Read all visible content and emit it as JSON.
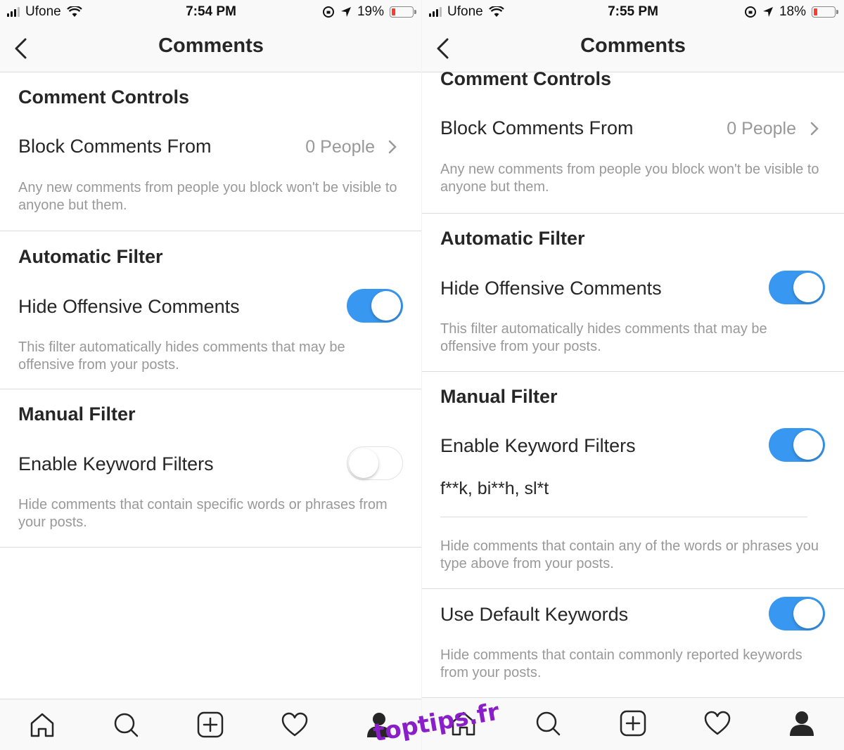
{
  "left": {
    "status": {
      "carrier": "Ufone",
      "time": "7:54 PM",
      "battery": "19%",
      "battery_level": 0.19
    },
    "nav": {
      "title": "Comments"
    },
    "comment_controls": {
      "title": "Comment Controls",
      "block_label": "Block Comments From",
      "block_value": "0 People",
      "block_desc": "Any new comments from people you block won't be visible to anyone but them."
    },
    "automatic_filter": {
      "title": "Automatic Filter",
      "hide_label": "Hide Offensive Comments",
      "hide_on": true,
      "hide_desc": "This filter automatically hides comments that may be offensive from your posts."
    },
    "manual_filter": {
      "title": "Manual Filter",
      "keyword_label": "Enable Keyword Filters",
      "keyword_on": false,
      "keyword_desc": "Hide comments that contain specific words or phrases from your posts."
    }
  },
  "right": {
    "status": {
      "carrier": "Ufone",
      "time": "7:55 PM",
      "battery": "18%",
      "battery_level": 0.18
    },
    "nav": {
      "title": "Comments"
    },
    "comment_controls": {
      "title": "Comment Controls",
      "block_label": "Block Comments From",
      "block_value": "0 People",
      "block_desc": "Any new comments from people you block won't be visible to anyone but them."
    },
    "automatic_filter": {
      "title": "Automatic Filter",
      "hide_label": "Hide Offensive Comments",
      "hide_on": true,
      "hide_desc": "This filter automatically hides comments that may be offensive from your posts."
    },
    "manual_filter": {
      "title": "Manual Filter",
      "keyword_label": "Enable Keyword Filters",
      "keyword_on": true,
      "keywords_text": "f**k, bi**h, sl*t",
      "keyword_desc": "Hide comments that contain any of the words or phrases you type above from your posts.",
      "default_label": "Use Default Keywords",
      "default_on": true,
      "default_desc": "Hide comments that contain commonly reported keywords from your posts."
    }
  },
  "tabs": [
    "home-icon",
    "search-icon",
    "add-icon",
    "heart-icon",
    "profile-icon"
  ],
  "watermark": "toptips.fr",
  "colors": {
    "accent": "#3897f0",
    "text": "#262626",
    "muted": "#999999",
    "battery_low": "#ff3b30"
  }
}
